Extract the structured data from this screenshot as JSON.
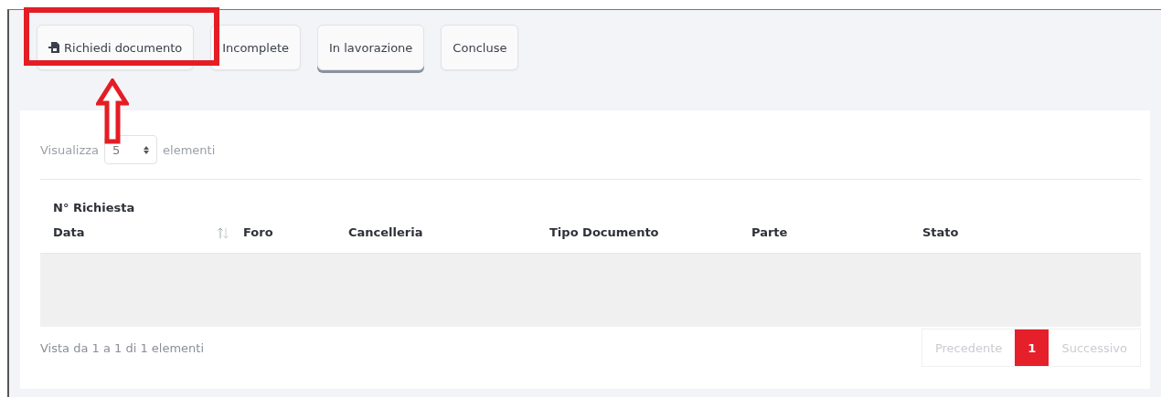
{
  "toolbar": {
    "buttons": [
      {
        "label": "Richiedi documento",
        "kind": "request",
        "selected": false,
        "highlighted": true
      },
      {
        "label": "Incomplete",
        "kind": "filter",
        "selected": false,
        "highlighted": false
      },
      {
        "label": "In lavorazione",
        "kind": "filter",
        "selected": true,
        "highlighted": false
      },
      {
        "label": "Concluse",
        "kind": "filter",
        "selected": false,
        "highlighted": false
      }
    ]
  },
  "page_length": {
    "prefix": "Visualizza",
    "value": "5",
    "suffix": "elementi"
  },
  "table": {
    "columns": [
      {
        "lines": [
          "N° Richiesta",
          "Data"
        ],
        "sortable": true
      },
      {
        "lines": [
          "Foro"
        ],
        "sortable": false
      },
      {
        "lines": [
          "Cancelleria"
        ],
        "sortable": false
      },
      {
        "lines": [
          "Tipo Documento"
        ],
        "sortable": false
      },
      {
        "lines": [
          "Parte"
        ],
        "sortable": false
      },
      {
        "lines": [
          "Stato"
        ],
        "sortable": false
      }
    ],
    "rows": [
      {
        "kind": "empty"
      }
    ]
  },
  "info": "Vista da 1 a 1 di 1 elementi",
  "pagination": [
    {
      "label": "Precedente",
      "selected": false,
      "disabled": true
    },
    {
      "label": "1",
      "selected": true,
      "disabled": false
    },
    {
      "label": "Successivo",
      "selected": false,
      "disabled": true
    }
  ]
}
